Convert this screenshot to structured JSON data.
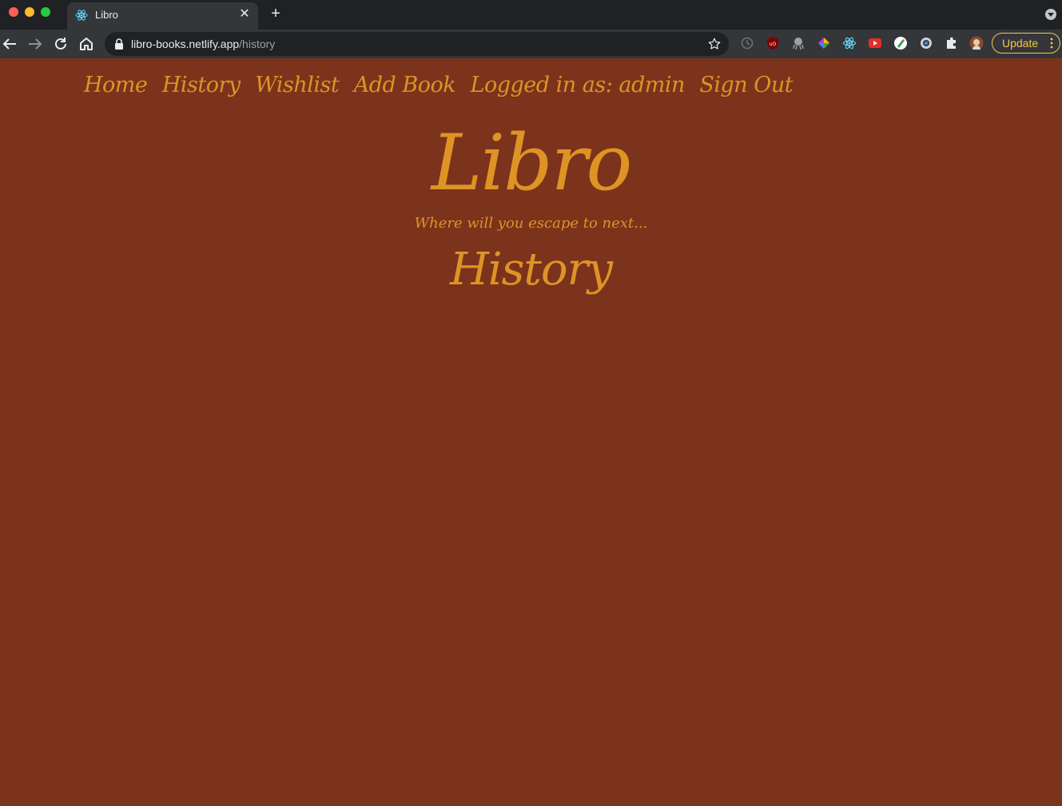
{
  "browser": {
    "tab_title": "Libro",
    "tab_close_glyph": "✕",
    "new_tab_glyph": "+",
    "url_host": "libro-books.netlify.app",
    "url_path": "/history",
    "update_label": "Update",
    "extensions": [
      "history-icon",
      "ublock-icon",
      "octopus-icon",
      "colorpick-icon",
      "react-devtools-icon",
      "youtube-icon",
      "pen-icon",
      "ring-icon",
      "puzzle-icon",
      "profile-avatar"
    ]
  },
  "nav": {
    "home": "Home",
    "history": "History",
    "wishlist": "Wishlist",
    "add_book": "Add Book",
    "logged_in": "Logged in as: admin",
    "sign_out": "Sign Out"
  },
  "brand": {
    "title": "Libro",
    "tagline": "Where will you escape to next..."
  },
  "main": {
    "heading": "History"
  },
  "colors": {
    "background": "#7b331c",
    "accent": "#de9325"
  }
}
